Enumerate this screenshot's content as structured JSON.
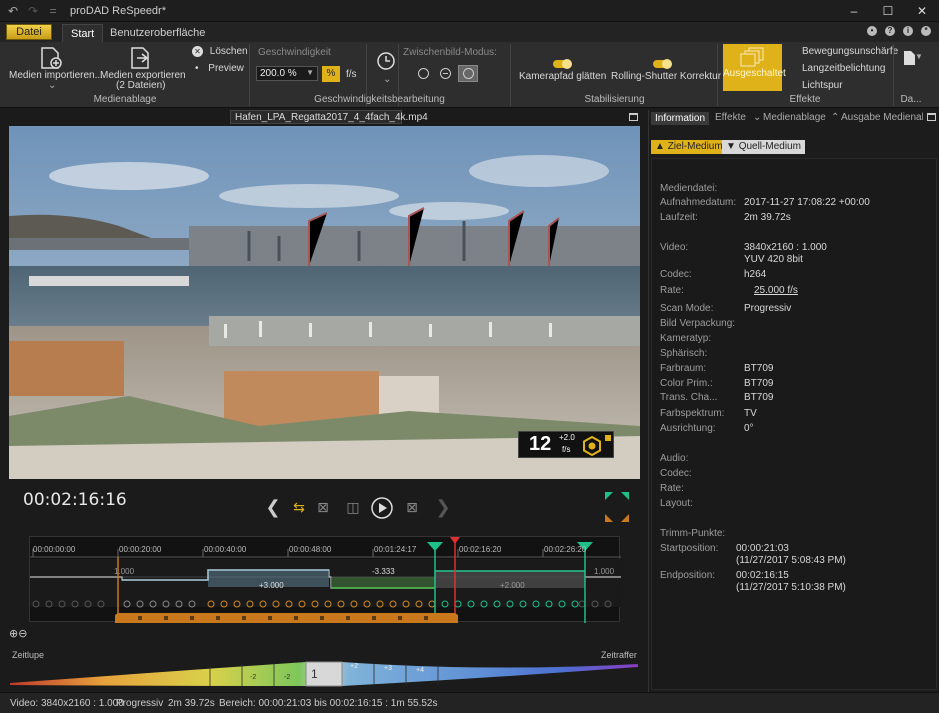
{
  "app": {
    "title": "proDAD ReSpeedr*"
  },
  "tabs": {
    "datei": "Datei",
    "start": "Start",
    "ui": "Benutzeroberfläche"
  },
  "ribbon": {
    "import_label": "Medien importieren...",
    "export_label1": "Medien exportieren",
    "export_label2": "(2 Dateien)",
    "delete_label": "Löschen",
    "preview_label": "Preview",
    "group_media": "Medienablage",
    "speed_title": "Geschwindigkeit",
    "speed_value": "200.0 %",
    "speed_pct": "%",
    "speed_fps": "f/s",
    "group_speed": "Geschwindigkeitsbearbeitung",
    "interp_title": "Zwischenbild-Modus:",
    "camera_label": "Kamerapfad glätten",
    "rolling_label": "Rolling-Shutter Korrektur",
    "group_stab": "Stabilisierung",
    "off_label": "Ausgeschaltet",
    "motion_blur": "Bewegungsunschärfe",
    "long_exp": "Langzeitbelichtung",
    "light_trail": "Lichtspur",
    "group_effects": "Effekte",
    "group_da": "Da..."
  },
  "preview": {
    "filename": "Hafen_LPA_Regatta2017_4_4fach_4k.mp4",
    "badge_num": "12",
    "badge_sup": "+2.0",
    "badge_unit": "f/s"
  },
  "transport": {
    "timecode": "00:02:16:16"
  },
  "timeline": {
    "ticks": [
      "00:00:00:00",
      "00:00:20:00",
      "00:00:40:00",
      "00:00:48:00",
      "00:01:24:17",
      "00:02:16:20",
      "00:02:26:20"
    ],
    "segments": [
      "1.000",
      "+3.000",
      "-3.333",
      "+2.000",
      "1.000"
    ]
  },
  "speedscale": {
    "left_label": "Zeitlupe",
    "right_label": "Zeitraffer",
    "center": "1",
    "neg": [
      "-2",
      "-2"
    ],
    "pos": [
      "+2",
      "+3",
      "+4"
    ]
  },
  "panel": {
    "tabs": [
      "Information",
      "Effekte",
      "Medienablage",
      "Ausgabe Medienablage"
    ],
    "target": "Ziel-Medium",
    "source": "Quell-Medium",
    "rows": [
      {
        "k": "Mediendatei:",
        "v": ""
      },
      {
        "k": "Aufnahmedatum:",
        "v": "2017-11-27 17:08:22 +00:00"
      },
      {
        "k": "Laufzeit:",
        "v": "2m 39.72s"
      },
      {
        "k": "Video:",
        "v": "3840x2160 : 1.000"
      },
      {
        "k": "",
        "v": "YUV 420 8bit"
      },
      {
        "k": "Codec:",
        "v": "h264"
      },
      {
        "k": "Rate:",
        "v": "25.000 f/s"
      },
      {
        "k": "Scan Mode:",
        "v": "Progressiv"
      },
      {
        "k": "Bild Verpackung:",
        "v": ""
      },
      {
        "k": "Kameratyp:",
        "v": ""
      },
      {
        "k": "Sphärisch:",
        "v": ""
      },
      {
        "k": "Farbraum:",
        "v": "BT709"
      },
      {
        "k": "Color Prim.:",
        "v": "BT709"
      },
      {
        "k": "Trans. Cha...",
        "v": "BT709"
      },
      {
        "k": "Farbspektrum:",
        "v": "TV"
      },
      {
        "k": "Ausrichtung:",
        "v": "0°"
      },
      {
        "k": "Audio:",
        "v": ""
      },
      {
        "k": "Codec:",
        "v": ""
      },
      {
        "k": "Rate:",
        "v": ""
      },
      {
        "k": "Layout:",
        "v": ""
      },
      {
        "k": "Trimm-Punkte:",
        "v": ""
      },
      {
        "k": "Startposition:",
        "v": "00:00:21:03"
      },
      {
        "k": "",
        "v": "(11/27/2017 5:08:43 PM)"
      },
      {
        "k": "Endposition:",
        "v": "00:02:16:15"
      },
      {
        "k": "",
        "v": "(11/27/2017 5:10:38 PM)"
      }
    ]
  },
  "status": {
    "video": "Video: 3840x2160 : 1.000",
    "scan": "Progressiv",
    "duration": "2m 39.72s",
    "range": "Bereich: 00:00:21:03 bis 00:02:16:15 : 1m 55.52s"
  },
  "colors": {
    "accent": "#e0b21a",
    "green": "#1ec08a",
    "orange": "#c9791c",
    "red": "#e03030"
  }
}
